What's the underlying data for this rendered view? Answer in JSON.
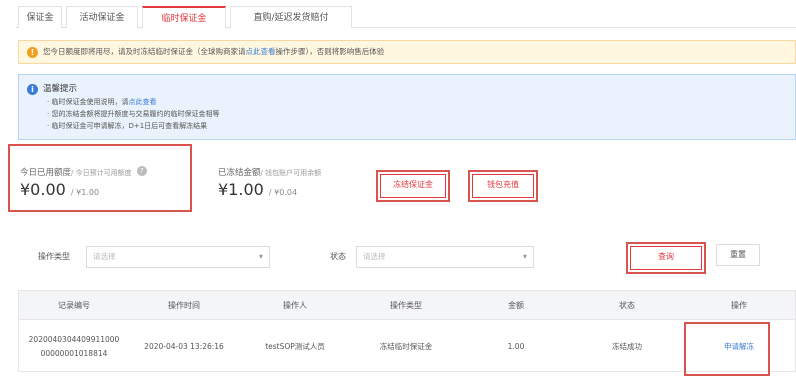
{
  "tabs": [
    {
      "label": "保证金",
      "active": false
    },
    {
      "label": "活动保证金",
      "active": false
    },
    {
      "label": "临时保证金",
      "active": true
    },
    {
      "label": "直购/延迟发货赔付",
      "active": false
    }
  ],
  "warning": {
    "text_before": "您今日额度即将用尽，请及时冻结临时保证金（全球购商家请",
    "link": "点此查看",
    "text_after": "操作步骤），否则将影响售后体验"
  },
  "info": {
    "title": "温馨提示",
    "line1_prefix": "· 临时保证金使用说明，请",
    "line1_link": "点此查看",
    "line2": "· 您的冻结金额将提升额度与交易履约的临时保证金相等",
    "line3": "· 临时保证金可申请解冻，D+1日后可查看解冻结果"
  },
  "stats": {
    "used": {
      "label": "今日已用额度",
      "sub": "/ 今日预计可用额度",
      "amount": "¥0.00",
      "total": "/ ¥1.00"
    },
    "frozen": {
      "label": "已冻结金额",
      "sub": "/ 钱包账户可用余额",
      "amount": "¥1.00",
      "total": "/ ¥0.04"
    },
    "freeze_button": "冻结保证金",
    "recharge_button": "钱包充值"
  },
  "filters": {
    "op_type_label": "操作类型",
    "op_type_placeholder": "请选择",
    "status_label": "状态",
    "status_placeholder": "请选择",
    "query_button": "查询",
    "reset_button": "重置"
  },
  "table": {
    "headers": [
      "记录编号",
      "操作时间",
      "操作人",
      "操作类型",
      "金额",
      "状态",
      "操作"
    ],
    "rows": [
      {
        "id_line1": "2020040304409911000",
        "id_line2": "00000001018814",
        "time": "2020-04-03 13:26:16",
        "operator": "testSOP测试人员",
        "type": "冻结临时保证金",
        "amount": "1.00",
        "status": "冻结成功",
        "action": "申请解冻"
      }
    ]
  }
}
